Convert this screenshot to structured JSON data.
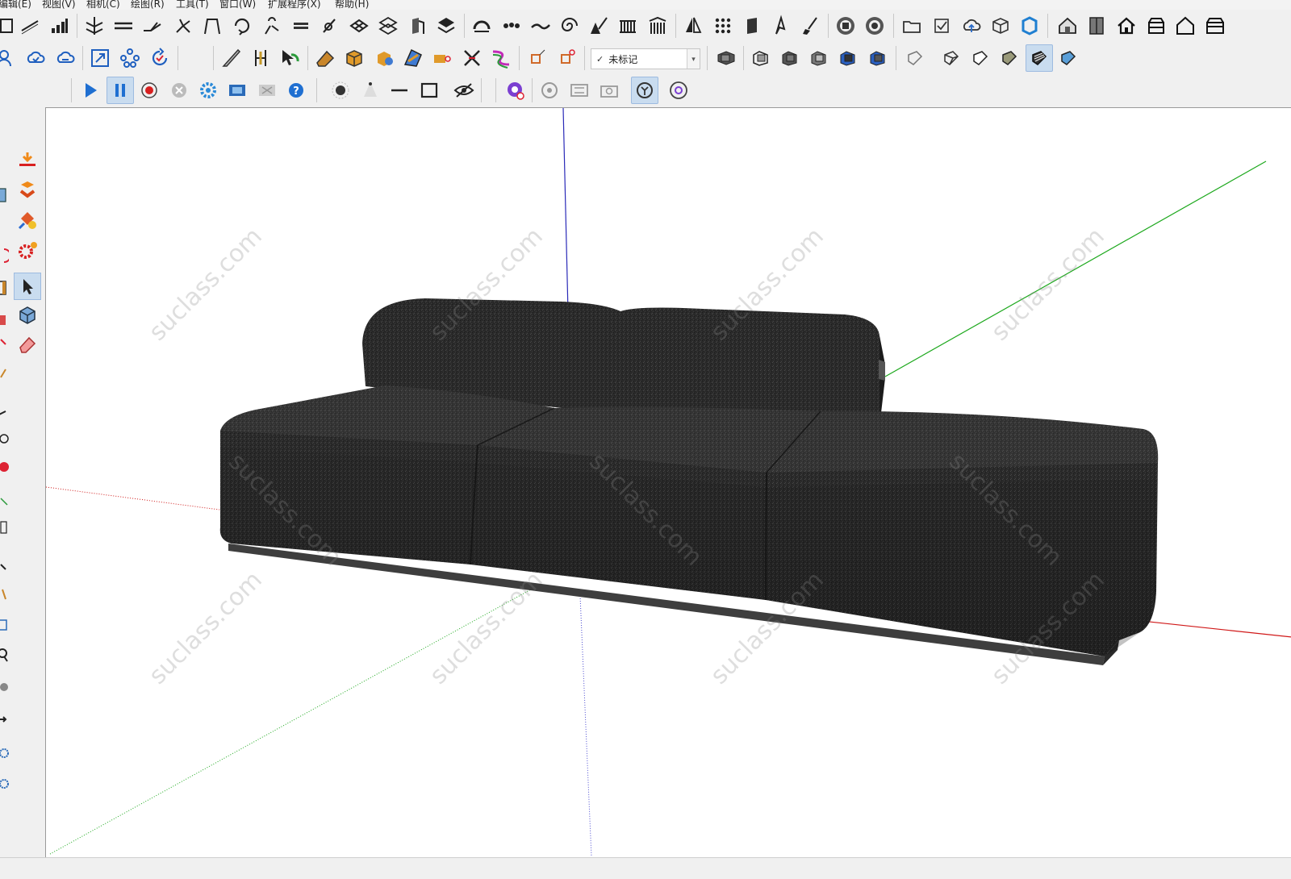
{
  "menu": {
    "items": [
      "编辑(E)",
      "视图(V)",
      "相机(C)",
      "绘图(R)",
      "工具(T)",
      "窗口(W)",
      "扩展程序(X)",
      "帮助(H)"
    ]
  },
  "toolbar": {
    "tag_dropdown": {
      "check": "✓",
      "value": "未标记",
      "caret": "▾"
    }
  },
  "scene": {
    "watermark": "suclass.com",
    "model": "sofa",
    "colors": {
      "axis_blue": "#2a2ab8",
      "axis_green": "#1ca81c",
      "axis_red": "#d01818",
      "fabric": "#2b2b2b",
      "base": "#3e3e3e"
    }
  },
  "icons": {
    "row1": [
      "table-icon",
      "line-icon",
      "bar-chart-icon",
      "roof-icon",
      "wall-icon",
      "slope-icon",
      "tree-icon",
      "fork-icon",
      "arch-icon",
      "rotate-icon",
      "spring-icon",
      "stairs-icon",
      "pen-icon",
      "tile-icon",
      "grid-icon",
      "door-icon",
      "hatch-icon",
      "dome-icon",
      "dots-icon",
      "wave-icon",
      "spiral-icon",
      "fence-icon",
      "railing-icon",
      "column-icon",
      "mirror-icon",
      "array-icon",
      "panel-icon",
      "cursor-pen-icon",
      "brush-icon",
      "render-a-icon",
      "render-b-icon",
      "folder-icon",
      "check-icon",
      "cloud-icon",
      "box-icon",
      "extension-icon",
      "house-3d-icon",
      "book-icon",
      "home-icon",
      "building-a-icon",
      "house-outline-icon",
      "building-b-icon"
    ],
    "row2": [
      "person-icon",
      "cloud-sync-icon",
      "cloud-arrow-icon",
      "scale-icon",
      "network-icon",
      "refresh-icon",
      "knife-icon",
      "frame-icon",
      "select-arrow-icon",
      "erase-tool-icon",
      "box-orange-icon",
      "cylinder-icon",
      "plane-icon",
      "shape-icon",
      "scissors-icon",
      "curve-icon",
      "corner-a-icon",
      "corner-b-icon",
      "layers-a-icon",
      "layers-b-icon",
      "layers-c-icon",
      "layers-d-icon",
      "layers-e-icon",
      "layers-f-icon",
      "style-wire-icon",
      "style-hidden-icon",
      "style-shaded-icon",
      "style-textured-icon",
      "style-mono-icon",
      "style-xray-icon"
    ],
    "row3": [
      "play-icon",
      "pause-icon",
      "record-icon",
      "stop-icon",
      "settings-icon",
      "film-icon",
      "film-off-icon",
      "help-icon",
      "point-light-icon",
      "spot-light-icon",
      "line-light-icon",
      "rect-light-icon",
      "eye-off-icon",
      "pin-icon",
      "orbit-icon",
      "sliders-icon",
      "camera-icon",
      "timer-icon",
      "flower-icon"
    ]
  }
}
